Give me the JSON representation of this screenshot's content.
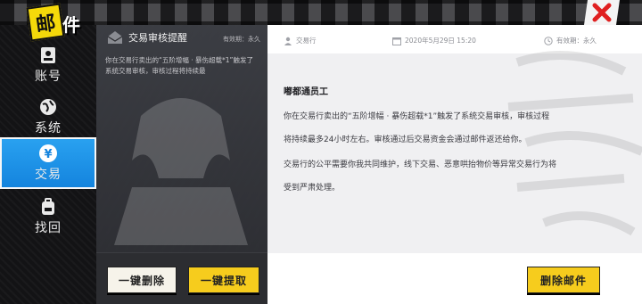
{
  "app": {
    "logo_char": "邮",
    "logo_text": "件"
  },
  "sidebar": {
    "items": [
      {
        "label": "账号",
        "icon": "id-card-icon",
        "active": false
      },
      {
        "label": "系统",
        "icon": "globe-icon",
        "active": false
      },
      {
        "label": "交易",
        "icon": "yen-coin-icon",
        "active": true
      },
      {
        "label": "找回",
        "icon": "backpack-icon",
        "active": false
      }
    ]
  },
  "mail_list": {
    "cards": [
      {
        "title": "交易审核提醒",
        "validity": "有效期：永久",
        "preview": "你在交易行卖出的“五阶增幅 · 暴伤超载*1”触发了系统交易审核，审核过程将持续最"
      }
    ],
    "delete_all_label": "一键删除",
    "claim_all_label": "一键提取"
  },
  "detail": {
    "sender": "交易行",
    "date": "2020年5月29日 15:20",
    "validity": "有效期：永久",
    "greeting": "嘟都通员工",
    "paragraphs": [
      "你在交易行卖出的“五阶增幅 · 暴伤超载*1”触发了系统交易审核，审核过程",
      "将持续最多24小时左右。审核通过后交易资金会通过邮件返还给你。",
      "交易行的公平需要你我共同维护，线下交易、恶意哄抬物价等异常交易行为将",
      "受到严肃处理。"
    ],
    "delete_mail_label": "删除邮件"
  },
  "colors": {
    "accent_blue": "#1f93e8",
    "button_yellow": "#f6cc1d",
    "button_white": "#f6f3ea",
    "close_red": "#e02020"
  }
}
